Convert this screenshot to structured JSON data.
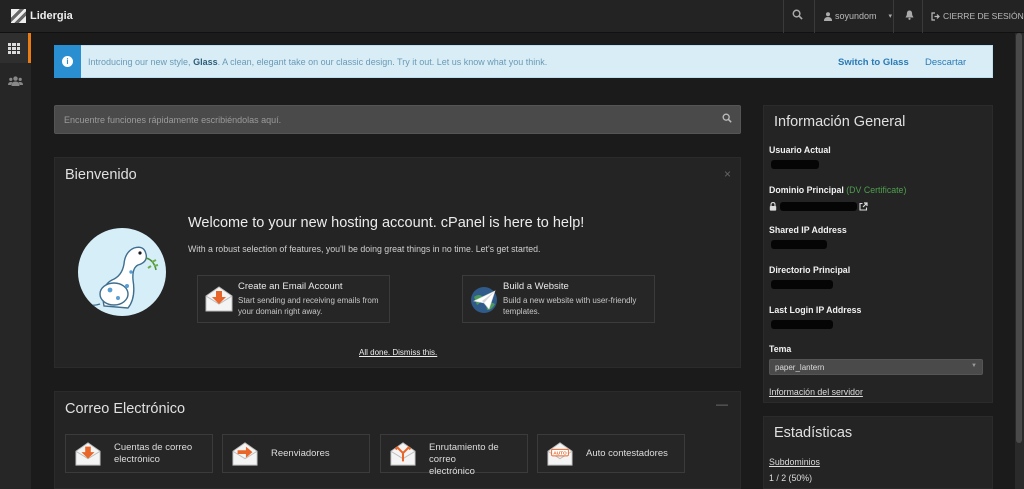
{
  "topbar": {
    "logo_text": "Lidergia",
    "username": "soyundom",
    "logout_label": "CIERRE DE SESIÓN"
  },
  "icons": {
    "search": "search-icon",
    "user": "user-icon",
    "bell": "bell-icon",
    "logout": "logout-icon",
    "tools_grid": "grid-icon",
    "users": "users-icon"
  },
  "notice": {
    "text_before": "Introducing our new style, ",
    "text_bold": "Glass",
    "text_after": ". A clean, elegant take on our classic design. Try it out. Let us know what you think.",
    "switch_label": "Switch to Glass",
    "dismiss_label": "Descartar"
  },
  "quick_search": {
    "placeholder": "Encuentre funciones rápidamente escribiéndolas aquí."
  },
  "welcome": {
    "title": "Bienvenido",
    "heading": "Welcome to your new hosting account. cPanel is here to help!",
    "subtext": "With a robust selection of features, you'll be doing great things in no time. Let's get started.",
    "cards": [
      {
        "title": "Create an Email Account",
        "desc_line1": "Start sending and receiving emails from",
        "desc_line2": "your domain right away."
      },
      {
        "title": "Build a Website",
        "desc_line1": "Build a new website with user-friendly",
        "desc_line2": "templates."
      }
    ],
    "dismiss_label": "All done. Dismiss this."
  },
  "email_section": {
    "title": "Correo Electrónico",
    "features": [
      {
        "line1": "Cuentas de correo",
        "line2": "electrónico"
      },
      {
        "line1": "Reenviadores",
        "line2": ""
      },
      {
        "line1": "Enrutamiento de correo",
        "line2": "electrónico"
      },
      {
        "line1": "Auto contestadores",
        "line2": ""
      }
    ],
    "auto_icon_text": "AUTO"
  },
  "general_info": {
    "title": "Información General",
    "current_user_label": "Usuario Actual",
    "primary_domain_label": "Dominio Principal",
    "certificate_label": "(DV Certificate)",
    "shared_ip_label": "Shared IP Address",
    "home_dir_label": "Directorio Principal",
    "last_login_label": "Last Login IP Address",
    "theme_label": "Tema",
    "theme_value": "paper_lantern",
    "server_info_link": "Información del servidor"
  },
  "stats": {
    "title": "Estadísticas",
    "subdomains_label": "Subdominios",
    "subdomains_value": "1 / 2   (50%)"
  },
  "colors": {
    "accent_orange": "#e97d13",
    "notice_bg": "#d9edf7",
    "link_blue": "#2a7ab5",
    "cert_green": "#4f9e4f"
  }
}
